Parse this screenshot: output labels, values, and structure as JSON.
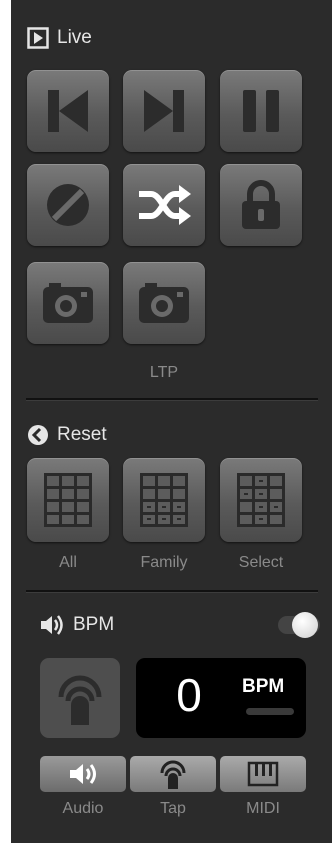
{
  "live": {
    "title": "Live",
    "buttons": [
      {
        "icon": "skip-back-icon"
      },
      {
        "icon": "skip-forward-icon"
      },
      {
        "icon": "pause-icon"
      },
      {
        "icon": "no-entry-icon"
      },
      {
        "icon": "shuffle-icon"
      },
      {
        "icon": "lock-icon"
      },
      {
        "icon": "camera-icon"
      },
      {
        "icon": "camera-icon"
      }
    ],
    "ltp_label": "LTP"
  },
  "reset": {
    "title": "Reset",
    "buttons": [
      {
        "label": "All",
        "icon": "grid-all-icon"
      },
      {
        "label": "Family",
        "icon": "grid-family-icon"
      },
      {
        "label": "Select",
        "icon": "grid-select-icon"
      }
    ]
  },
  "bpm": {
    "title": "BPM",
    "toggle_on": true,
    "value": "0",
    "unit_label": "BPM",
    "sources": [
      {
        "label": "Audio",
        "icon": "speaker-icon"
      },
      {
        "label": "Tap",
        "icon": "tap-icon"
      },
      {
        "label": "MIDI",
        "icon": "midi-keyboard-icon"
      }
    ]
  },
  "colors": {
    "panel": "#2b2b2b",
    "button": "#666666",
    "text": "#dcdcdc",
    "muted": "#8a8a8a"
  }
}
